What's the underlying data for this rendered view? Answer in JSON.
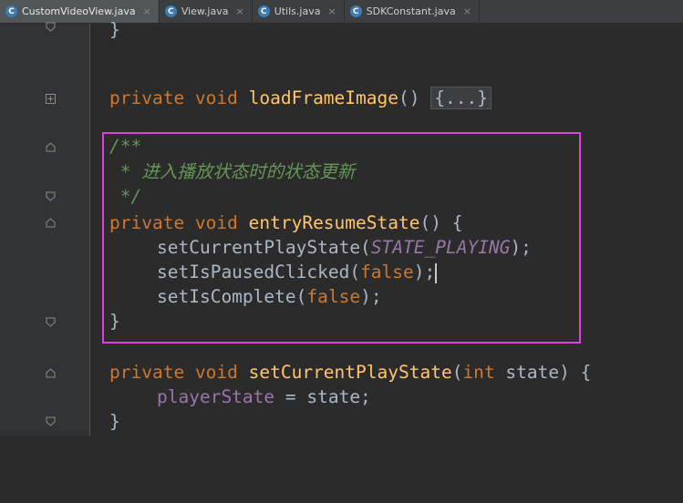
{
  "tabs": [
    {
      "label": "CustomVideoView.java",
      "icon": "C",
      "active": true
    },
    {
      "label": "View.java",
      "icon": "C",
      "active": false
    },
    {
      "label": "Utils.java",
      "icon": "C",
      "active": false
    },
    {
      "label": "SDKConstant.java",
      "icon": "C",
      "active": false
    }
  ],
  "tab_close_glyph": "×",
  "code": {
    "line0": "}",
    "line1": {
      "kw": "private void ",
      "fn": "loadFrameImage",
      "paren": "() ",
      "folded": "{...}"
    },
    "line2": "/**",
    "line3": " * 进入播放状态时的状态更新",
    "line4": " */",
    "line5": {
      "kw": "private void ",
      "fn": "entryResumeState",
      "rest": "() {"
    },
    "line6": {
      "call": "setCurrentPlayState(",
      "const": "STATE_PLAYING",
      "end": ");"
    },
    "line7": {
      "call": "setIsPausedClicked(",
      "kw": "false",
      "end": ");"
    },
    "line8": {
      "call": "setIsComplete(",
      "kw": "false",
      "end": ");"
    },
    "line9": "}",
    "line10": {
      "kw": "private void ",
      "fn": "setCurrentPlayState",
      "open": "(",
      "kw2": "int ",
      "rest": "state) {"
    },
    "line11": {
      "field": "playerState",
      "rest": " = state;"
    },
    "line12": "}"
  },
  "colors": {
    "highlight": "#e040e0",
    "keyword": "#cc7832",
    "function": "#ffc66d",
    "comment": "#629755",
    "field": "#9876aa"
  }
}
